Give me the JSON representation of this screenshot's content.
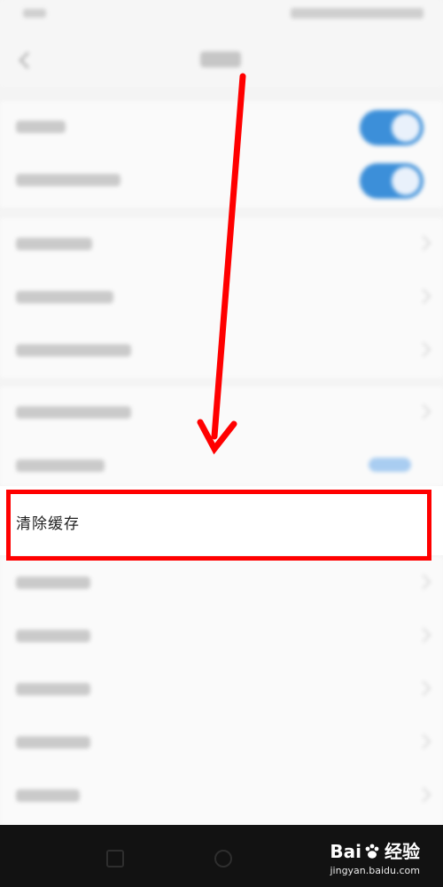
{
  "clear_cache": {
    "label": "清除缓存"
  },
  "watermark": {
    "brand_left": "Bai",
    "brand_right": "经验",
    "site": "jingyan.baidu.com"
  },
  "colors": {
    "highlight": "#ff0000",
    "arrow": "#ff0000",
    "toggle": "#3c8fd9"
  },
  "toggles": [
    {
      "state": "on"
    },
    {
      "state": "on"
    }
  ],
  "icons": {
    "back": "chevron-left-icon",
    "row": "chevron-right-icon",
    "baidu": "paw-icon"
  }
}
